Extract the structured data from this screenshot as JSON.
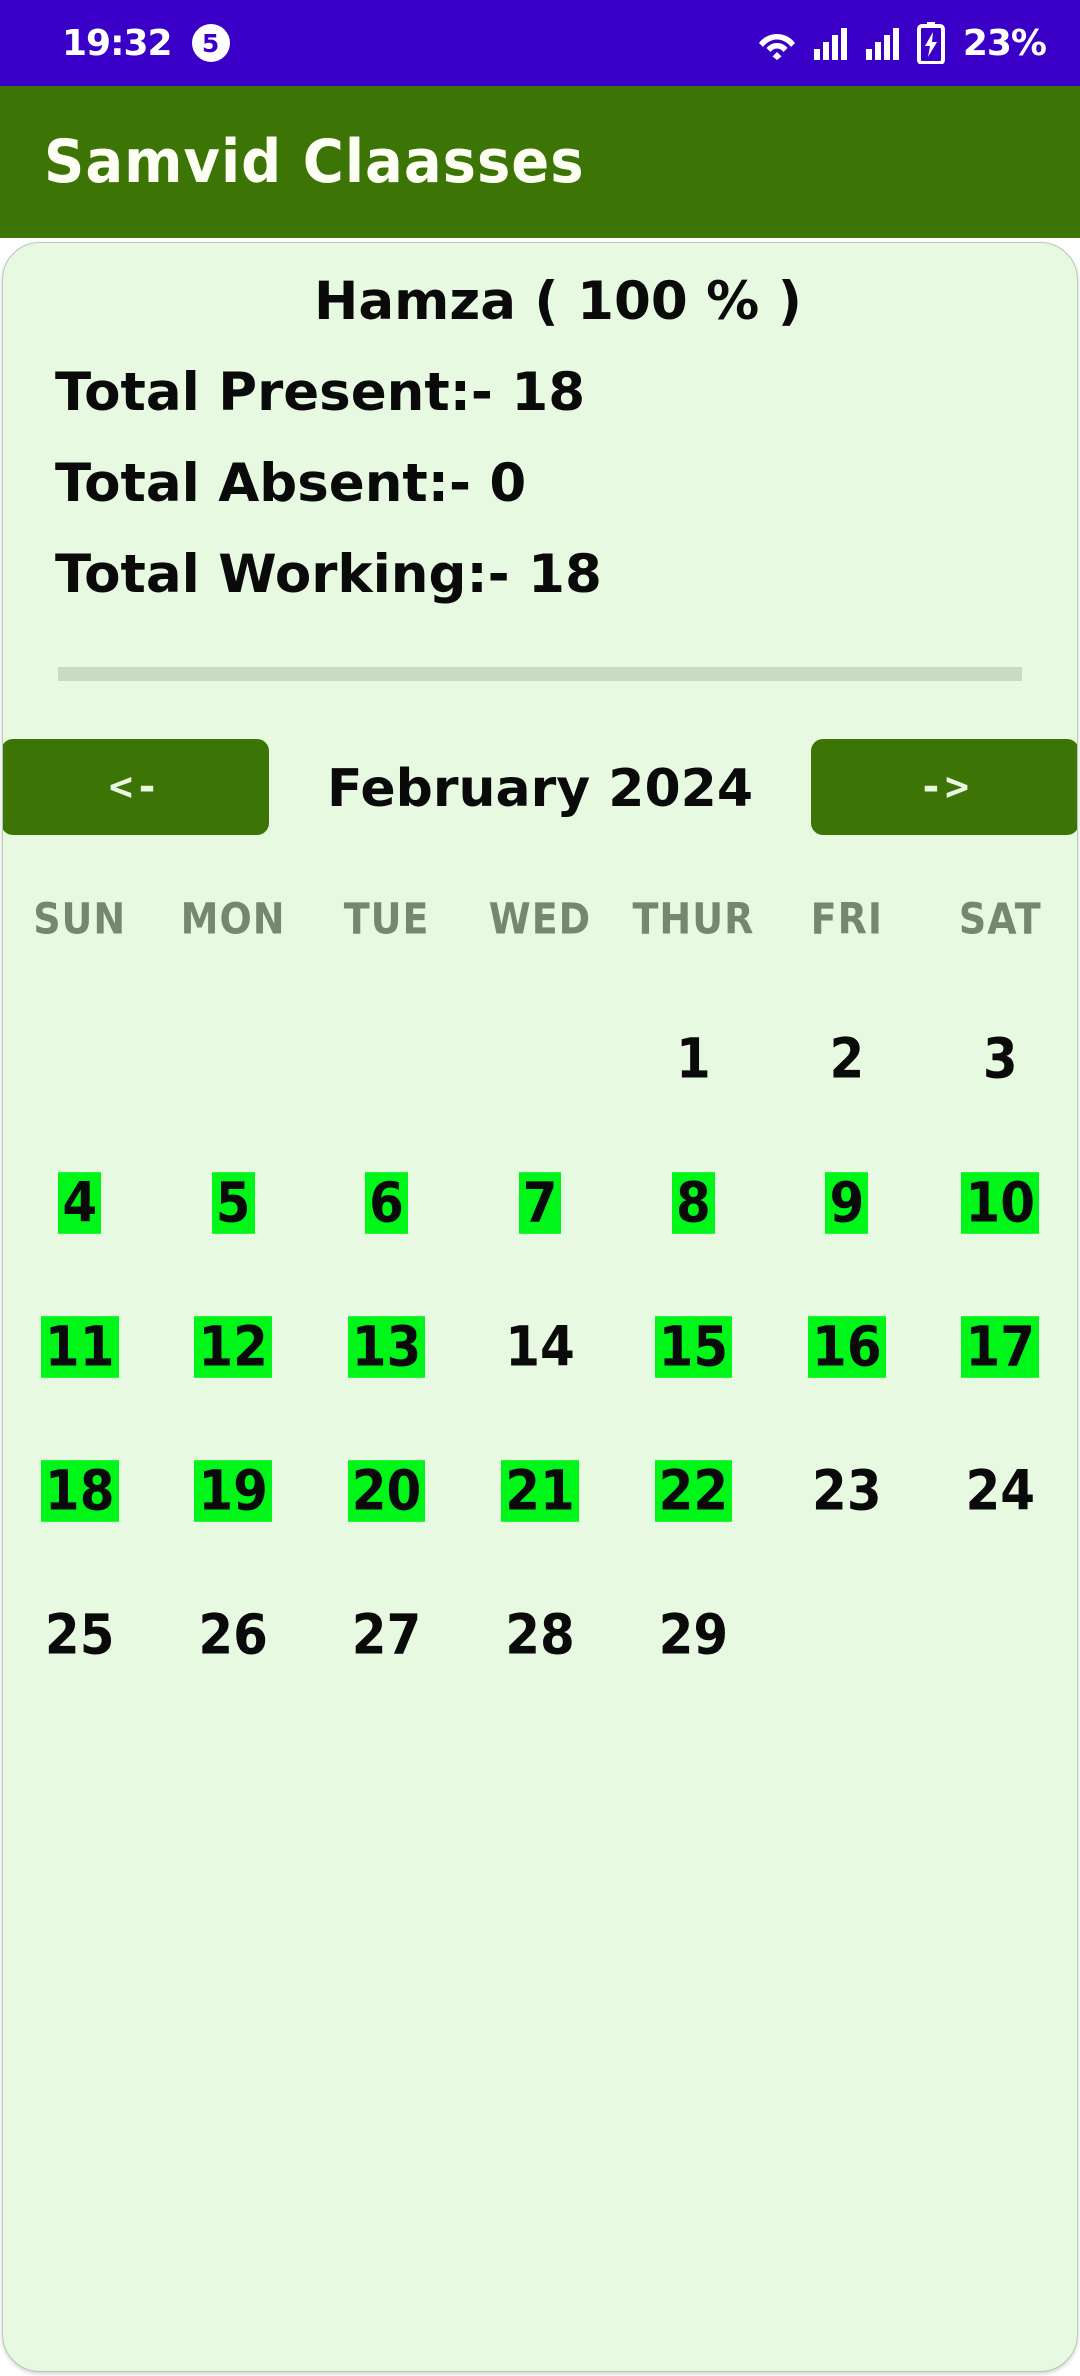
{
  "status_bar": {
    "time": "19:32",
    "notification_badge": "5",
    "battery_percent": "23%",
    "icons": [
      "wifi-icon",
      "signal-icon",
      "signal-icon",
      "battery-charging-icon"
    ],
    "background_color": "#3a00c8"
  },
  "app_bar": {
    "title": "Samvid Claasses",
    "background_color": "#3c7505",
    "text_color": "#fdfff5"
  },
  "summary": {
    "student_heading": "Hamza  ( 100 % )",
    "total_present": "Total Present:- 18",
    "total_absent": "Total Absent:- 0",
    "total_working": "Total Working:- 18"
  },
  "calendar": {
    "prev_label": "<-",
    "next_label": "->",
    "month_label": "February 2024",
    "weekdays": [
      "SUN",
      "MON",
      "TUE",
      "WED",
      "THUR",
      "FRI",
      "SAT"
    ],
    "present_color": "#00f519",
    "cells": [
      {
        "day": "",
        "present": false
      },
      {
        "day": "",
        "present": false
      },
      {
        "day": "",
        "present": false
      },
      {
        "day": "",
        "present": false
      },
      {
        "day": "1",
        "present": false
      },
      {
        "day": "2",
        "present": false
      },
      {
        "day": "3",
        "present": false
      },
      {
        "day": "4",
        "present": true
      },
      {
        "day": "5",
        "present": true
      },
      {
        "day": "6",
        "present": true
      },
      {
        "day": "7",
        "present": true
      },
      {
        "day": "8",
        "present": true
      },
      {
        "day": "9",
        "present": true
      },
      {
        "day": "10",
        "present": true
      },
      {
        "day": "11",
        "present": true
      },
      {
        "day": "12",
        "present": true
      },
      {
        "day": "13",
        "present": true
      },
      {
        "day": "14",
        "present": false
      },
      {
        "day": "15",
        "present": true
      },
      {
        "day": "16",
        "present": true
      },
      {
        "day": "17",
        "present": true
      },
      {
        "day": "18",
        "present": true
      },
      {
        "day": "19",
        "present": true
      },
      {
        "day": "20",
        "present": true
      },
      {
        "day": "21",
        "present": true
      },
      {
        "day": "22",
        "present": true
      },
      {
        "day": "23",
        "present": false
      },
      {
        "day": "24",
        "present": false
      },
      {
        "day": "25",
        "present": false
      },
      {
        "day": "26",
        "present": false
      },
      {
        "day": "27",
        "present": false
      },
      {
        "day": "28",
        "present": false
      },
      {
        "day": "29",
        "present": false
      },
      {
        "day": "",
        "present": false
      },
      {
        "day": "",
        "present": false
      }
    ]
  }
}
